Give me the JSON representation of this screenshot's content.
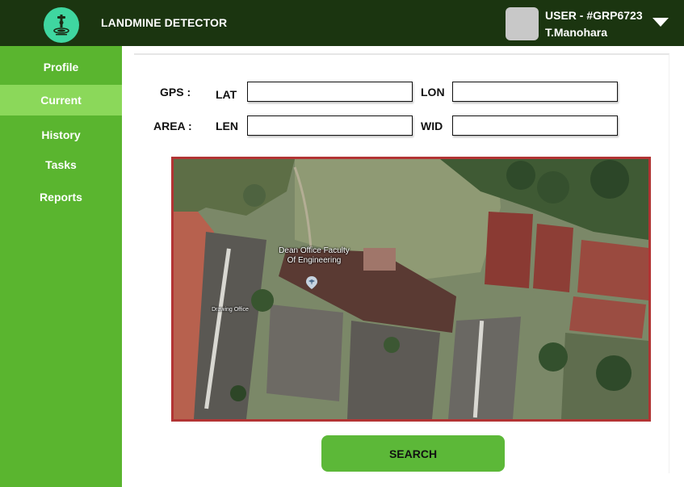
{
  "header": {
    "app_title": "LANDMINE DETECTOR",
    "user_id": "USER - #GRP6723",
    "user_name": "T.Manohara",
    "logo_icon": "landmine-detector-icon",
    "menu_icon": "chevron-down-icon"
  },
  "sidebar": {
    "items": [
      {
        "label": "Profile",
        "active": false
      },
      {
        "label": "Current",
        "active": true
      },
      {
        "label": "History",
        "active": false
      },
      {
        "label": "Tasks",
        "active": false
      },
      {
        "label": "Reports",
        "active": false
      }
    ]
  },
  "form": {
    "gps_label": "GPS :",
    "lat_label": "LAT",
    "lat_value": "",
    "lon_label": "LON",
    "lon_value": "",
    "area_label": "AREA :",
    "len_label": "LEN",
    "len_value": "",
    "wid_label": "WID",
    "wid_value": ""
  },
  "map": {
    "place_label": "Dean Office Faculty\nOf Engineering",
    "place_label_line1": "Dean Office Faculty",
    "place_label_line2": "Of Engineering",
    "secondary_label": "Drawing Office",
    "pin_icon": "school-pin-icon"
  },
  "search": {
    "label": "SEARCH"
  },
  "colors": {
    "header_bg": "#1b3510",
    "sidebar_bg": "#5ab52f",
    "sidebar_active": "#8bd85a",
    "logo_bg": "#3fd6a0",
    "button_bg": "#5cb838",
    "map_border": "#b23434"
  }
}
